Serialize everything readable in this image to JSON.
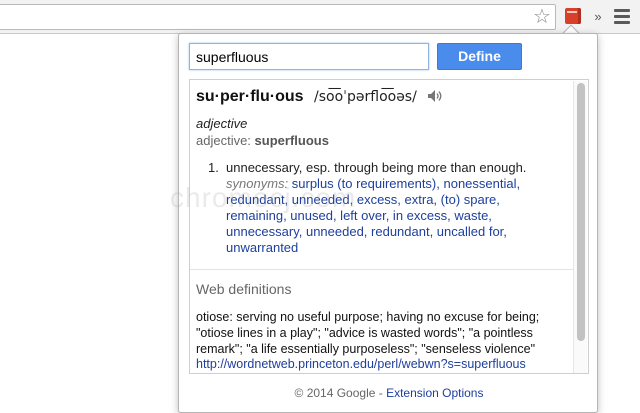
{
  "browser": {
    "star_icon": "star-icon",
    "extension_icon": "dictionary-book-icon",
    "overflow_icon": "chevron-double-right-icon",
    "menu_icon": "hamburger-menu-icon",
    "overflow_glyph": "»"
  },
  "popup": {
    "search": {
      "value": "superfluous"
    },
    "define_label": "Define",
    "entry": {
      "headword": "su·per·flu·ous",
      "pronunciation": "/so͞oˈpərflo͞oəs/",
      "speaker_icon": "speaker-icon",
      "pos": "adjective",
      "pos_line_prefix": "adjective:",
      "pos_line_word": "superfluous",
      "senses": [
        {
          "number": "1.",
          "definition": "unnecessary, esp. through being more than enough.",
          "synonyms_label": "synonyms:",
          "synonyms": "surplus (to requirements), nonessential, redundant, unneeded, excess, extra, (to) spare, remaining, unused, left over, in excess, waste, unnecessary, unneeded, redundant, uncalled for, unwarranted"
        }
      ]
    },
    "web": {
      "heading": "Web definitions",
      "definition": "otiose: serving no useful purpose; having no excuse for being; \"otiose lines in a play\"; \"advice is wasted words\"; \"a pointless remark\"; \"a life essentially purposeless\"; \"senseless violence\"",
      "link": "http://wordnetweb.princeton.edu/perl/webwn?s=superfluous"
    },
    "footer": {
      "copyright": "© 2014 Google -",
      "link": "Extension Options"
    }
  },
  "watermark": "chromecj.com"
}
